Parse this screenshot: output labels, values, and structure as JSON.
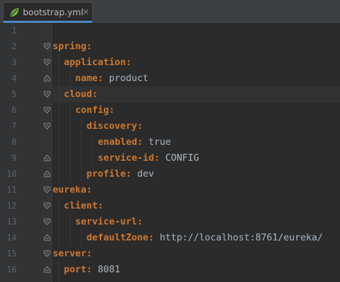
{
  "tab": {
    "filename": "bootstrap.yml",
    "close": "×",
    "icon": "leaf-icon"
  },
  "colors": {
    "key": "#cc7832",
    "value": "#a9b7c6",
    "background": "#2b2b2b",
    "gutter": "#313335",
    "line_number": "#606366"
  },
  "lines": [
    {
      "n": "1",
      "indent": 0,
      "key": "",
      "value": ""
    },
    {
      "n": "2",
      "indent": 0,
      "key": "spring:",
      "value": ""
    },
    {
      "n": "3",
      "indent": 1,
      "key": "application:",
      "value": ""
    },
    {
      "n": "4",
      "indent": 2,
      "key": "name:",
      "value": "product"
    },
    {
      "n": "5",
      "indent": 1,
      "key": "cloud:",
      "value": ""
    },
    {
      "n": "6",
      "indent": 2,
      "key": "config:",
      "value": ""
    },
    {
      "n": "7",
      "indent": 3,
      "key": "discovery:",
      "value": ""
    },
    {
      "n": "8",
      "indent": 4,
      "key": "enabled:",
      "value": "true"
    },
    {
      "n": "9",
      "indent": 4,
      "key": "service-id:",
      "value": "CONFIG"
    },
    {
      "n": "10",
      "indent": 3,
      "key": "profile:",
      "value": "dev"
    },
    {
      "n": "11",
      "indent": 0,
      "key": "eureka:",
      "value": ""
    },
    {
      "n": "12",
      "indent": 1,
      "key": "client:",
      "value": ""
    },
    {
      "n": "13",
      "indent": 2,
      "key": "service-url:",
      "value": ""
    },
    {
      "n": "14",
      "indent": 3,
      "key": "defaultZone:",
      "value": "http://localhost:8761/eureka/"
    },
    {
      "n": "15",
      "indent": 0,
      "key": "server:",
      "value": ""
    },
    {
      "n": "16",
      "indent": 1,
      "key": "port:",
      "value": "8081"
    }
  ]
}
